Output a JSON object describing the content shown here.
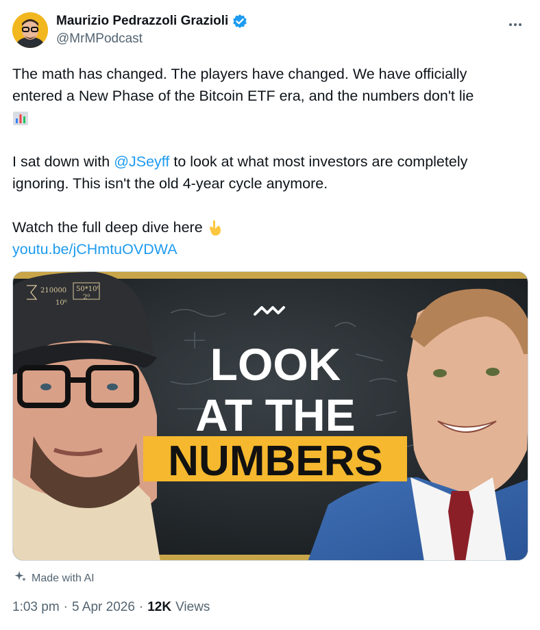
{
  "author": {
    "display_name": "Maurizio Pedrazzoli Grazioli",
    "handle": "@MrMPodcast",
    "verified": true
  },
  "tweet": {
    "line1": "The math has changed. The players have changed. We have officially",
    "line2": "entered a New Phase of the Bitcoin ETF era, and the numbers don't lie",
    "chart_emoji": "📊",
    "line3_prefix": "I sat down with ",
    "mention": "@JSeyff",
    "line3_suffix": " to look at what most investors are completely",
    "line4": "ignoring. This isn't the old 4-year cycle anymore.",
    "line5": "Watch the full deep dive here",
    "point_emoji": "👇",
    "url": "youtu.be/jCHmtuOVDWA"
  },
  "media": {
    "thumbnail_line1": "LOOK",
    "thumbnail_line2": "AT THE",
    "thumbnail_line3": "NUMBERS",
    "cap_text_1": "210000",
    "cap_text_2": "50*10⁶",
    "cap_text_3": "2⁰",
    "cap_text_4": "10⁶"
  },
  "labels": {
    "made_with_ai": "Made with AI"
  },
  "meta": {
    "time": "1:03 pm",
    "date": "5 Apr 2026",
    "views_count": "12K",
    "views_label": "Views"
  },
  "colors": {
    "link": "#1d9bf0",
    "secondary_text": "#536471",
    "verified_badge": "#1d9bf0",
    "thumbnail_highlight": "#f5b82e"
  }
}
